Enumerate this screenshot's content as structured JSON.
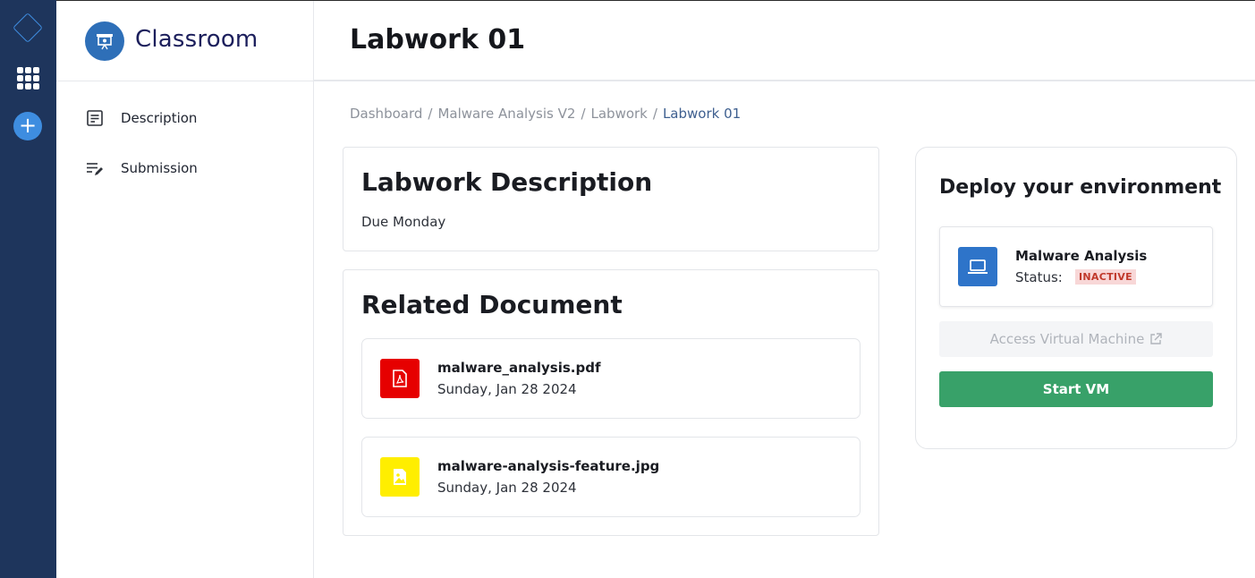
{
  "app": {
    "name": "Classroom"
  },
  "rail": {
    "icons": [
      "logo-diamond-icon",
      "apps-grid-icon",
      "plus-icon"
    ],
    "accent": "#3e8de0",
    "background": "#1e355c"
  },
  "sidebar": {
    "items": [
      {
        "label": "Description",
        "icon": "description-icon"
      },
      {
        "label": "Submission",
        "icon": "submission-icon"
      }
    ]
  },
  "header": {
    "title": "Labwork 01"
  },
  "breadcrumb": [
    "Dashboard",
    "Malware Analysis V2",
    "Labwork",
    "Labwork 01"
  ],
  "description": {
    "heading": "Labwork Description",
    "due": "Due Monday"
  },
  "related": {
    "heading": "Related Document",
    "documents": [
      {
        "name": "malware_analysis.pdf",
        "date": "Sunday, Jan 28 2024",
        "icon": "pdf-icon",
        "color": "#e60000"
      },
      {
        "name": "malware-analysis-feature.jpg",
        "date": "Sunday, Jan 28 2024",
        "icon": "image-icon",
        "color": "#ffee00"
      }
    ]
  },
  "deploy": {
    "heading": "Deploy your environment",
    "machine": {
      "name": "Malware Analysis",
      "status_label": "Status:",
      "status": "INACTIVE",
      "icon": "laptop-icon"
    },
    "access_label": "Access Virtual Machine",
    "start_label": "Start VM",
    "start_color": "#38a169"
  }
}
